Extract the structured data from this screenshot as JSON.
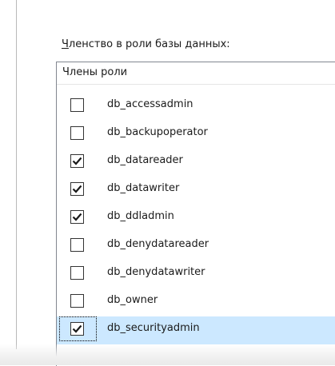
{
  "membership": {
    "label_mnemonic": "Ч",
    "label_rest": "ленство в роли базы данных:",
    "column_header": "Члены роли",
    "roles": [
      {
        "name": "db_accessadmin",
        "checked": false,
        "selected": false
      },
      {
        "name": "db_backupoperator",
        "checked": false,
        "selected": false
      },
      {
        "name": "db_datareader",
        "checked": true,
        "selected": false
      },
      {
        "name": "db_datawriter",
        "checked": true,
        "selected": false
      },
      {
        "name": "db_ddladmin",
        "checked": true,
        "selected": false
      },
      {
        "name": "db_denydatareader",
        "checked": false,
        "selected": false
      },
      {
        "name": "db_denydatawriter",
        "checked": false,
        "selected": false
      },
      {
        "name": "db_owner",
        "checked": false,
        "selected": false
      },
      {
        "name": "db_securityadmin",
        "checked": true,
        "selected": true
      }
    ]
  },
  "colors": {
    "selection": "#cce8ff",
    "checkbox_border": "#333333",
    "list_border": "#828790"
  },
  "icons": {
    "checked": "checkmark-icon"
  }
}
